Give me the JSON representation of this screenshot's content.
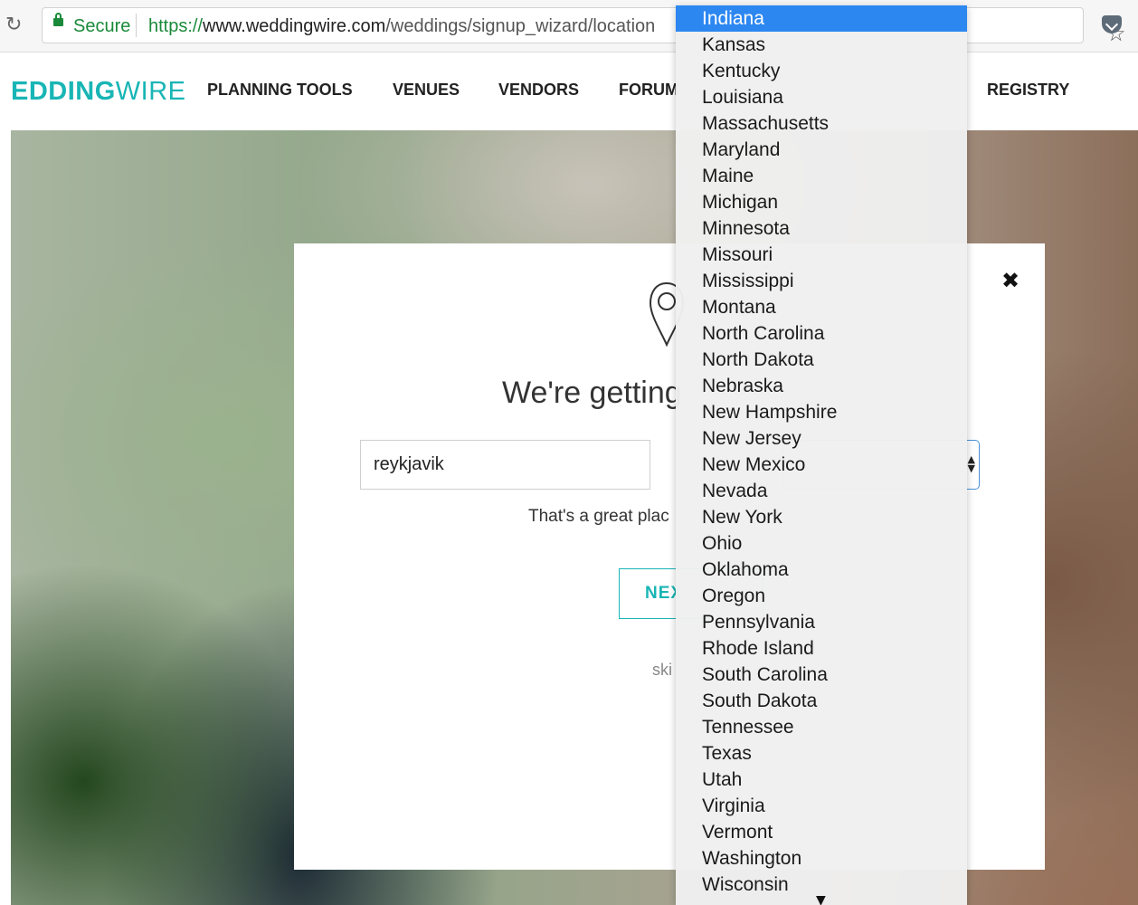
{
  "browser": {
    "secure_label": "Secure",
    "url_scheme": "https://",
    "url_host": "www.weddingwire.com",
    "url_path": "/weddings/signup_wizard/location",
    "reload_icon": "reload-icon",
    "star_icon": "bookmark-star-icon",
    "pocket_icon": "pocket-icon"
  },
  "site": {
    "logo_bold": "EDDING",
    "logo_light": "WIRE",
    "nav": [
      "PLANNING TOOLS",
      "VENUES",
      "VENDORS",
      "FORUM",
      "REGISTRY"
    ]
  },
  "modal": {
    "heading": "We're getting",
    "city_value": "reykjavik",
    "message": "That's a great plac",
    "next_label": "NEX",
    "skip_label": "ski",
    "close_symbol": "✖"
  },
  "state_dropdown": {
    "selected": "Indiana",
    "options": [
      "Indiana",
      "Kansas",
      "Kentucky",
      "Louisiana",
      "Massachusetts",
      "Maryland",
      "Maine",
      "Michigan",
      "Minnesota",
      "Missouri",
      "Mississippi",
      "Montana",
      "North Carolina",
      "North Dakota",
      "Nebraska",
      "New Hampshire",
      "New Jersey",
      "New Mexico",
      "Nevada",
      "New York",
      "Ohio",
      "Oklahoma",
      "Oregon",
      "Pennsylvania",
      "Rhode Island",
      "South Carolina",
      "South Dakota",
      "Tennessee",
      "Texas",
      "Utah",
      "Virginia",
      "Vermont",
      "Washington",
      "Wisconsin"
    ]
  },
  "colors": {
    "brand": "#19b5b5",
    "selected_option": "#2c87f0",
    "secure_green": "#1a8a3a"
  }
}
